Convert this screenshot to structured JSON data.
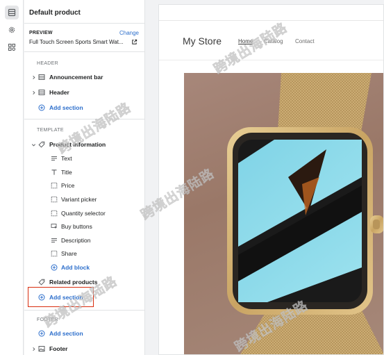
{
  "sidebar": {
    "title": "Default product",
    "preview": {
      "label": "PREVIEW",
      "change_label": "Change",
      "value": "Full Touch Screen Sports Smart Wat..."
    },
    "header_group": {
      "label": "HEADER",
      "items": [
        "Announcement bar",
        "Header"
      ],
      "add_label": "Add section"
    },
    "template_group": {
      "label": "TEMPLATE",
      "section": "Product information",
      "blocks": [
        "Text",
        "Title",
        "Price",
        "Variant picker",
        "Quantity selector",
        "Buy buttons",
        "Description",
        "Share"
      ],
      "add_block_label": "Add block",
      "related": "Related products",
      "add_label": "Add section"
    },
    "footer_group": {
      "label": "FOOTER",
      "add_label": "Add section",
      "items": [
        "Footer"
      ]
    }
  },
  "store": {
    "name": "My Store",
    "nav": [
      "Home",
      "Catalog",
      "Contact"
    ]
  },
  "watermark_text": "跨境出海陆路"
}
